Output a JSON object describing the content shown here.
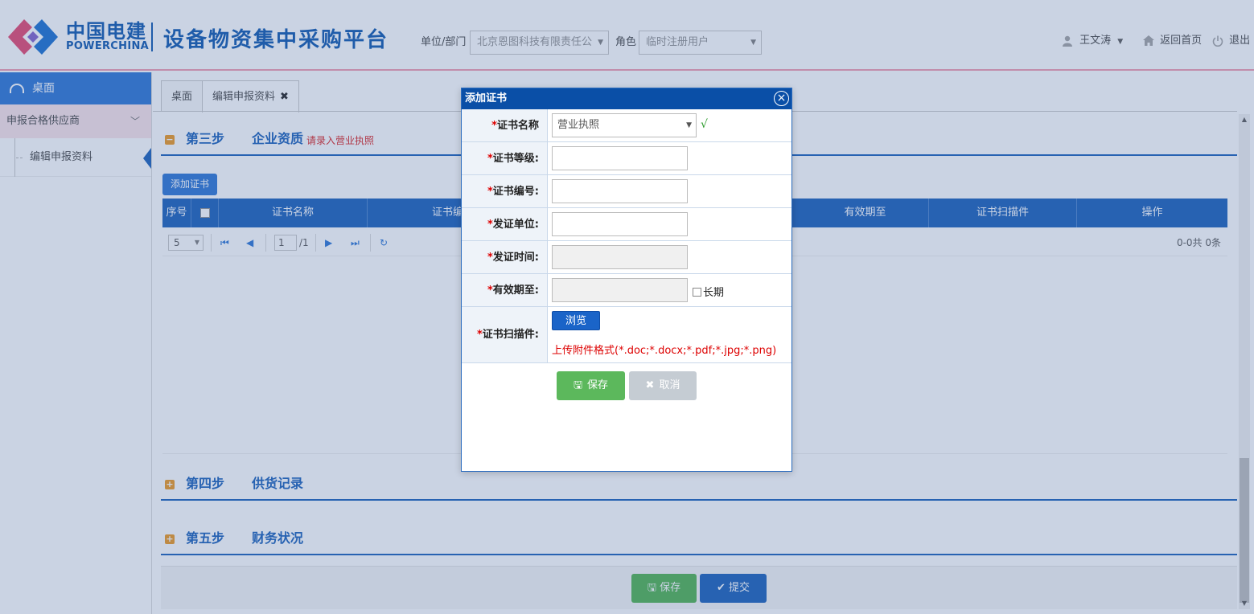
{
  "header": {
    "brand_cn": "中国电建",
    "brand_en": "POWERCHINA",
    "platform_title": "设备物资集中采购平台",
    "unit_label": "单位/部门",
    "unit_value": "北京恩图科技有限责任公",
    "role_label": "角色",
    "role_value": "临时注册用户",
    "user_name": "王文涛",
    "home_label": "返回首页",
    "logout_label": "退出"
  },
  "sidebar": {
    "desk_label": "桌面",
    "group_label": "申报合格供应商",
    "sub_label": "编辑申报资料"
  },
  "tabs": [
    {
      "label": "桌面"
    },
    {
      "label": "编辑申报资料",
      "close": "✖"
    }
  ],
  "steps": {
    "step3": {
      "toggle": "−",
      "num": "第三步",
      "name": "企业资质",
      "hint": "请录入营业执照"
    },
    "step4": {
      "toggle": "+",
      "num": "第四步",
      "name": "供货记录"
    },
    "step5": {
      "toggle": "+",
      "num": "第五步",
      "name": "财务状况"
    }
  },
  "grid": {
    "add_button": "添加证书",
    "columns": [
      "序号",
      "证书名称",
      "证书编",
      "有效期至",
      "证书扫描件",
      "操作"
    ],
    "pager": {
      "page_size": "5",
      "page": "1",
      "total_pages": "/1",
      "count": "0-0共 0条"
    }
  },
  "bottom": {
    "save_label": "保存",
    "submit_label": "提交"
  },
  "dialog": {
    "title": "添加证书",
    "close_icon": "⊗",
    "fields": {
      "name_label": "证书名称",
      "name_value": "营业执照",
      "ok_mark": "√",
      "grade_label": "证书等级:",
      "number_label": "证书编号:",
      "issuer_label": "发证单位:",
      "issue_date_label": "发证时间:",
      "expiry_label": "有效期至:",
      "long_term_label": "长期",
      "scan_label": "证书扫描件:",
      "required_mark": "*"
    },
    "browse_label": "浏览",
    "upload_hint": "上传附件格式(*.doc;*.docx;*.pdf;*.jpg;*.png)",
    "save_label": "保存",
    "cancel_label": "取消"
  },
  "colors": {
    "brand_blue": "#1f63b4",
    "primary": "#2a6bbf",
    "dialog_title": "#0a4fa7",
    "save_green": "#5cb85c",
    "cancel_grey": "#c5ccd3",
    "required_red": "#d00",
    "accent_pink": "#f3a2b6"
  }
}
